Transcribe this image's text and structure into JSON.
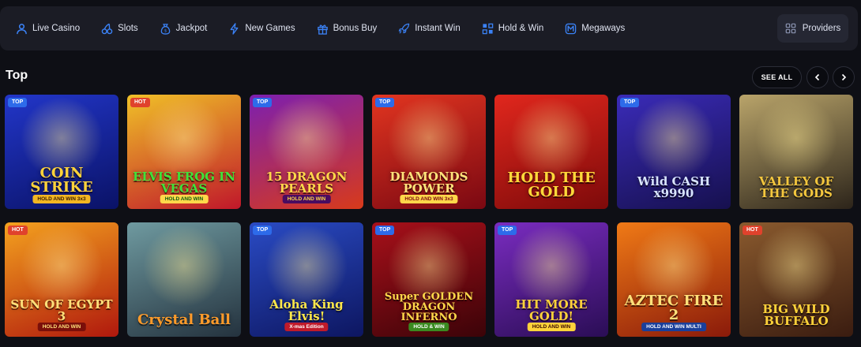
{
  "nav": {
    "items": [
      {
        "label": "Live Casino",
        "icon": "live-casino-icon"
      },
      {
        "label": "Slots",
        "icon": "cherries-icon"
      },
      {
        "label": "Jackpot",
        "icon": "money-bag-icon"
      },
      {
        "label": "New Games",
        "icon": "lightning-icon"
      },
      {
        "label": "Bonus Buy",
        "icon": "gift-icon"
      },
      {
        "label": "Instant Win",
        "icon": "rocket-icon"
      },
      {
        "label": "Hold & Win",
        "icon": "puzzle-icon"
      },
      {
        "label": "Megaways",
        "icon": "megaways-m-icon"
      }
    ],
    "providers_label": "Providers",
    "accent": "#3b82f6"
  },
  "section": {
    "title": "Top",
    "see_all_label": "SEE ALL"
  },
  "badge_colors": {
    "TOP": "#2d6bea",
    "HOT": "#e0422c"
  },
  "games": [
    {
      "title": "COIN STRIKE",
      "subtitle": "HOLD AND WIN 3x3",
      "badge": "TOP",
      "colors": [
        "#2236c9",
        "#0a1266"
      ],
      "text_color": "#ffd23a",
      "sub_bg": "#f2b622",
      "sub_color": "#3a1c00"
    },
    {
      "title": "ELVIS FROG IN VEGAS",
      "subtitle": "HOLD AND WIN",
      "badge": "HOT",
      "colors": [
        "#f0c128",
        "#c0172a"
      ],
      "text_color": "#3fe23a",
      "sub_bg": "#ffd84a",
      "sub_color": "#0a5a12"
    },
    {
      "title": "15 DRAGON PEARLS",
      "subtitle": "HOLD AND WIN",
      "badge": "TOP",
      "colors": [
        "#7c1fb0",
        "#d83a1a"
      ],
      "text_color": "#ffd84a",
      "sub_bg": "#4a0c60",
      "sub_color": "#ffd84a"
    },
    {
      "title": "DIAMONDS POWER",
      "subtitle": "HOLD AND WIN 3x3",
      "badge": "TOP",
      "colors": [
        "#e23520",
        "#7a0812"
      ],
      "text_color": "#ffe27a",
      "sub_bg": "#ffd84a",
      "sub_color": "#7a0812"
    },
    {
      "title": "HOLD THE GOLD",
      "subtitle": "",
      "badge": "",
      "colors": [
        "#e1271d",
        "#7d0a0a"
      ],
      "text_color": "#ffd93a",
      "sub_bg": "",
      "sub_color": ""
    },
    {
      "title": "Wild CASH x9990",
      "subtitle": "",
      "badge": "TOP",
      "colors": [
        "#3a2bb8",
        "#16104e"
      ],
      "text_color": "#d8e4ff",
      "sub_bg": "",
      "sub_color": ""
    },
    {
      "title": "VALLEY OF THE GODS",
      "subtitle": "",
      "badge": "",
      "colors": [
        "#b9a46a",
        "#2c241a"
      ],
      "text_color": "#f4c73e",
      "sub_bg": "",
      "sub_color": ""
    },
    {
      "title": "SUN OF EGYPT 3",
      "subtitle": "HOLD AND WIN",
      "badge": "HOT",
      "colors": [
        "#f4a21f",
        "#b0180d"
      ],
      "text_color": "#ffe07a",
      "sub_bg": "#7a0f0a",
      "sub_color": "#ffe07a"
    },
    {
      "title": "Crystal Ball",
      "subtitle": "",
      "badge": "",
      "colors": [
        "#6f9aa0",
        "#24323e"
      ],
      "text_color": "#ff9b2a",
      "sub_bg": "",
      "sub_color": ""
    },
    {
      "title": "Aloha King Elvis!",
      "subtitle": "X-mas Edition",
      "badge": "TOP",
      "colors": [
        "#2a4bc4",
        "#0d1660"
      ],
      "text_color": "#ffe84a",
      "sub_bg": "#c01a2a",
      "sub_color": "#ffffff"
    },
    {
      "title": "Super GOLDEN DRAGON INFERNO",
      "subtitle": "HOLD & WIN",
      "badge": "TOP",
      "colors": [
        "#a8101a",
        "#3b0308"
      ],
      "text_color": "#ffd84a",
      "sub_bg": "#3a8a20",
      "sub_color": "#ffffff"
    },
    {
      "title": "HIT MORE GOLD!",
      "subtitle": "HOLD AND WIN",
      "badge": "TOP",
      "colors": [
        "#7a2cc0",
        "#2a0d55"
      ],
      "text_color": "#ffd23a",
      "sub_bg": "#ffd23a",
      "sub_color": "#3a0b00"
    },
    {
      "title": "AZTEC FIRE 2",
      "subtitle": "HOLD AND WIN MULTI",
      "badge": "",
      "colors": [
        "#f07a16",
        "#8a1a0a"
      ],
      "text_color": "#ffe07a",
      "sub_bg": "#1a3f9a",
      "sub_color": "#ffffff"
    },
    {
      "title": "BIG WILD BUFFALO",
      "subtitle": "",
      "badge": "HOT",
      "colors": [
        "#8a5a2e",
        "#3a1c10"
      ],
      "text_color": "#ffd23a",
      "sub_bg": "",
      "sub_color": ""
    }
  ]
}
